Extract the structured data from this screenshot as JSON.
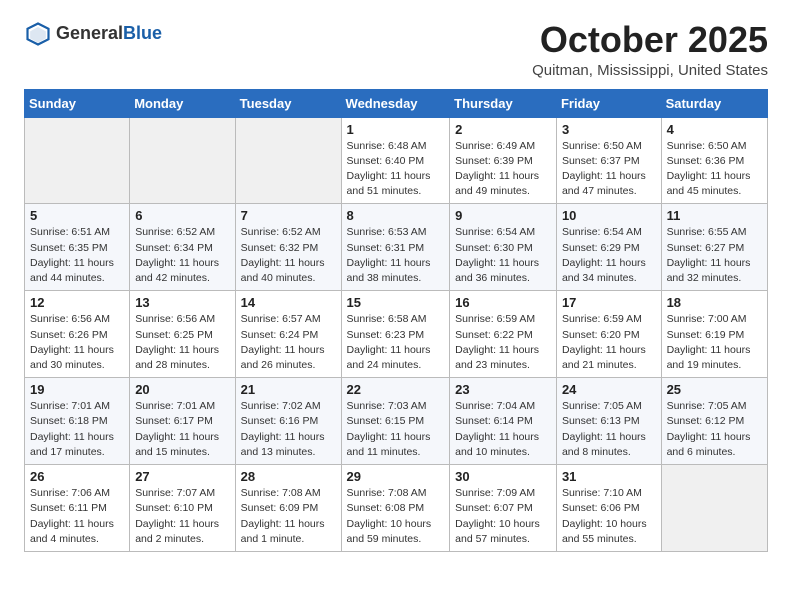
{
  "header": {
    "logo_general": "General",
    "logo_blue": "Blue",
    "month": "October 2025",
    "location": "Quitman, Mississippi, United States"
  },
  "weekdays": [
    "Sunday",
    "Monday",
    "Tuesday",
    "Wednesday",
    "Thursday",
    "Friday",
    "Saturday"
  ],
  "weeks": [
    [
      {
        "day": "",
        "info": ""
      },
      {
        "day": "",
        "info": ""
      },
      {
        "day": "",
        "info": ""
      },
      {
        "day": "1",
        "info": "Sunrise: 6:48 AM\nSunset: 6:40 PM\nDaylight: 11 hours\nand 51 minutes."
      },
      {
        "day": "2",
        "info": "Sunrise: 6:49 AM\nSunset: 6:39 PM\nDaylight: 11 hours\nand 49 minutes."
      },
      {
        "day": "3",
        "info": "Sunrise: 6:50 AM\nSunset: 6:37 PM\nDaylight: 11 hours\nand 47 minutes."
      },
      {
        "day": "4",
        "info": "Sunrise: 6:50 AM\nSunset: 6:36 PM\nDaylight: 11 hours\nand 45 minutes."
      }
    ],
    [
      {
        "day": "5",
        "info": "Sunrise: 6:51 AM\nSunset: 6:35 PM\nDaylight: 11 hours\nand 44 minutes."
      },
      {
        "day": "6",
        "info": "Sunrise: 6:52 AM\nSunset: 6:34 PM\nDaylight: 11 hours\nand 42 minutes."
      },
      {
        "day": "7",
        "info": "Sunrise: 6:52 AM\nSunset: 6:32 PM\nDaylight: 11 hours\nand 40 minutes."
      },
      {
        "day": "8",
        "info": "Sunrise: 6:53 AM\nSunset: 6:31 PM\nDaylight: 11 hours\nand 38 minutes."
      },
      {
        "day": "9",
        "info": "Sunrise: 6:54 AM\nSunset: 6:30 PM\nDaylight: 11 hours\nand 36 minutes."
      },
      {
        "day": "10",
        "info": "Sunrise: 6:54 AM\nSunset: 6:29 PM\nDaylight: 11 hours\nand 34 minutes."
      },
      {
        "day": "11",
        "info": "Sunrise: 6:55 AM\nSunset: 6:27 PM\nDaylight: 11 hours\nand 32 minutes."
      }
    ],
    [
      {
        "day": "12",
        "info": "Sunrise: 6:56 AM\nSunset: 6:26 PM\nDaylight: 11 hours\nand 30 minutes."
      },
      {
        "day": "13",
        "info": "Sunrise: 6:56 AM\nSunset: 6:25 PM\nDaylight: 11 hours\nand 28 minutes."
      },
      {
        "day": "14",
        "info": "Sunrise: 6:57 AM\nSunset: 6:24 PM\nDaylight: 11 hours\nand 26 minutes."
      },
      {
        "day": "15",
        "info": "Sunrise: 6:58 AM\nSunset: 6:23 PM\nDaylight: 11 hours\nand 24 minutes."
      },
      {
        "day": "16",
        "info": "Sunrise: 6:59 AM\nSunset: 6:22 PM\nDaylight: 11 hours\nand 23 minutes."
      },
      {
        "day": "17",
        "info": "Sunrise: 6:59 AM\nSunset: 6:20 PM\nDaylight: 11 hours\nand 21 minutes."
      },
      {
        "day": "18",
        "info": "Sunrise: 7:00 AM\nSunset: 6:19 PM\nDaylight: 11 hours\nand 19 minutes."
      }
    ],
    [
      {
        "day": "19",
        "info": "Sunrise: 7:01 AM\nSunset: 6:18 PM\nDaylight: 11 hours\nand 17 minutes."
      },
      {
        "day": "20",
        "info": "Sunrise: 7:01 AM\nSunset: 6:17 PM\nDaylight: 11 hours\nand 15 minutes."
      },
      {
        "day": "21",
        "info": "Sunrise: 7:02 AM\nSunset: 6:16 PM\nDaylight: 11 hours\nand 13 minutes."
      },
      {
        "day": "22",
        "info": "Sunrise: 7:03 AM\nSunset: 6:15 PM\nDaylight: 11 hours\nand 11 minutes."
      },
      {
        "day": "23",
        "info": "Sunrise: 7:04 AM\nSunset: 6:14 PM\nDaylight: 11 hours\nand 10 minutes."
      },
      {
        "day": "24",
        "info": "Sunrise: 7:05 AM\nSunset: 6:13 PM\nDaylight: 11 hours\nand 8 minutes."
      },
      {
        "day": "25",
        "info": "Sunrise: 7:05 AM\nSunset: 6:12 PM\nDaylight: 11 hours\nand 6 minutes."
      }
    ],
    [
      {
        "day": "26",
        "info": "Sunrise: 7:06 AM\nSunset: 6:11 PM\nDaylight: 11 hours\nand 4 minutes."
      },
      {
        "day": "27",
        "info": "Sunrise: 7:07 AM\nSunset: 6:10 PM\nDaylight: 11 hours\nand 2 minutes."
      },
      {
        "day": "28",
        "info": "Sunrise: 7:08 AM\nSunset: 6:09 PM\nDaylight: 11 hours\nand 1 minute."
      },
      {
        "day": "29",
        "info": "Sunrise: 7:08 AM\nSunset: 6:08 PM\nDaylight: 10 hours\nand 59 minutes."
      },
      {
        "day": "30",
        "info": "Sunrise: 7:09 AM\nSunset: 6:07 PM\nDaylight: 10 hours\nand 57 minutes."
      },
      {
        "day": "31",
        "info": "Sunrise: 7:10 AM\nSunset: 6:06 PM\nDaylight: 10 hours\nand 55 minutes."
      },
      {
        "day": "",
        "info": ""
      }
    ]
  ]
}
